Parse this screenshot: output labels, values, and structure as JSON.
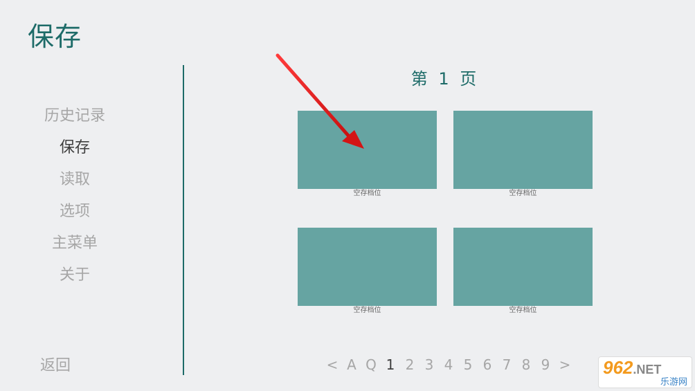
{
  "header": {
    "title": "保存"
  },
  "nav": {
    "items": [
      {
        "label": "历史记录",
        "name": "nav-history",
        "active": false
      },
      {
        "label": "保存",
        "name": "nav-save",
        "active": true
      },
      {
        "label": "读取",
        "name": "nav-load",
        "active": false
      },
      {
        "label": "选项",
        "name": "nav-options",
        "active": false
      },
      {
        "label": "主菜单",
        "name": "nav-main-menu",
        "active": false
      },
      {
        "label": "关于",
        "name": "nav-about",
        "active": false
      }
    ],
    "back_label": "返回"
  },
  "page": {
    "title": "第 1 页"
  },
  "slots": [
    {
      "label": "空存档位"
    },
    {
      "label": "空存档位"
    },
    {
      "label": "空存档位"
    },
    {
      "label": "空存档位"
    }
  ],
  "pager": {
    "prev": "<",
    "next": ">",
    "items": [
      "A",
      "Q",
      "1",
      "2",
      "3",
      "4",
      "5",
      "6",
      "7",
      "8",
      "9"
    ],
    "current": "1"
  },
  "watermark": {
    "top_num": "962",
    "top_suffix": ".NET",
    "bottom": "乐游网"
  },
  "colors": {
    "accent": "#1d6b68",
    "slot": "#66a4a2",
    "arrow": "#e01b1b",
    "background": "#eeeff1"
  }
}
